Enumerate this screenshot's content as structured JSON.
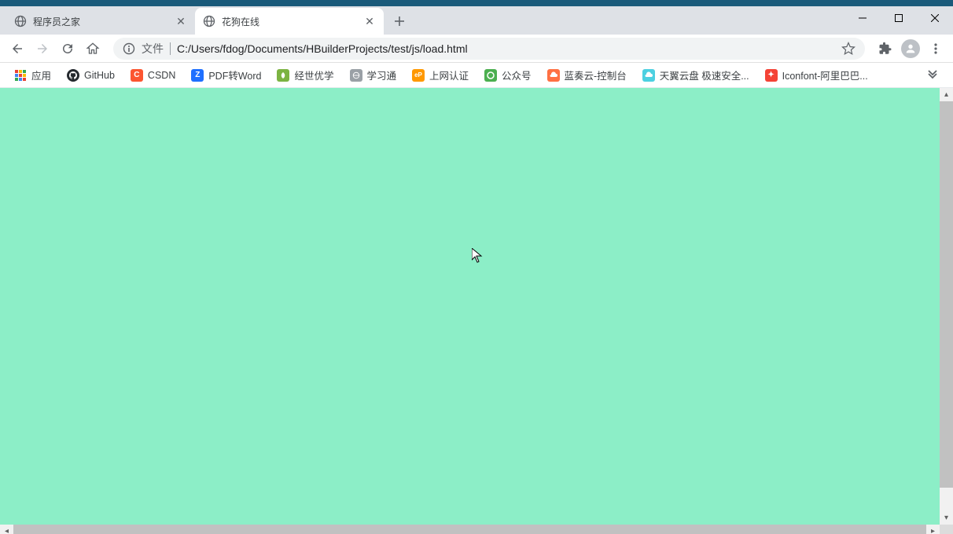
{
  "tabs": [
    {
      "title": "程序员之家",
      "active": false
    },
    {
      "title": "花狗在线",
      "active": true
    }
  ],
  "address": {
    "scheme_label": "文件",
    "path": "C:/Users/fdog/Documents/HBuilderProjects/test/js/load.html"
  },
  "bookmarks": {
    "apps_label": "应用",
    "items": [
      {
        "label": "GitHub",
        "icon": "github"
      },
      {
        "label": "CSDN",
        "icon": "csdn"
      },
      {
        "label": "PDF转Word",
        "icon": "pdf"
      },
      {
        "label": "经世优学",
        "icon": "jing"
      },
      {
        "label": "学习通",
        "icon": "globe"
      },
      {
        "label": "上网认证",
        "icon": "ep"
      },
      {
        "label": "公众号",
        "icon": "gzh"
      },
      {
        "label": "蓝奏云-控制台",
        "icon": "lan"
      },
      {
        "label": "天翼云盘 极速安全...",
        "icon": "ty"
      },
      {
        "label": "Iconfont-阿里巴巴...",
        "icon": "icon"
      }
    ]
  },
  "page_bg_color": "#8ceec7"
}
